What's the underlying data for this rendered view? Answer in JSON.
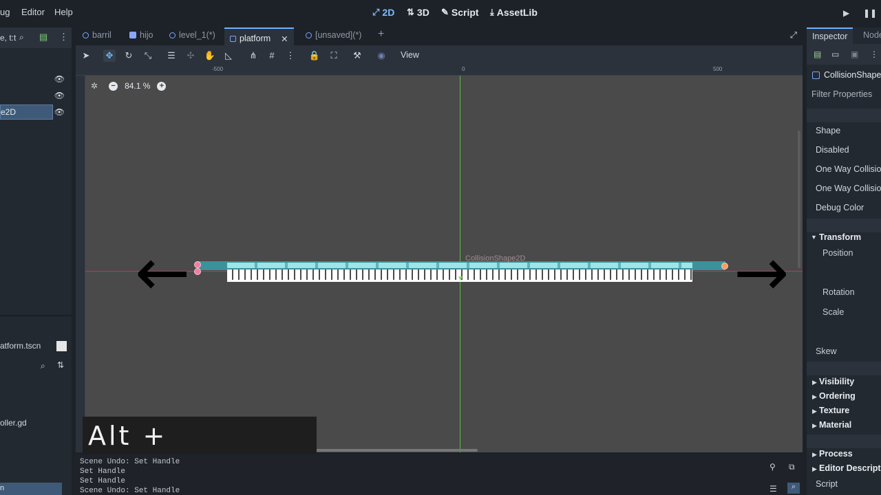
{
  "menu": {
    "debug": "ug",
    "editor": "Editor",
    "help": "Help"
  },
  "workspaces": {
    "ws2d": "2D",
    "ws3d": "3D",
    "script": "Script",
    "assetlib": "AssetLib"
  },
  "left_dock": {
    "filter_text": "e, t:t",
    "selected_node": "e2D",
    "scene_path": "atform.tscn",
    "file_item": "oller.gd",
    "selected_file": "n"
  },
  "tabs": [
    {
      "label": "barril"
    },
    {
      "label": "hijo"
    },
    {
      "label": "level_1(*)"
    },
    {
      "label": "platform"
    },
    {
      "label": "[unsaved](*)"
    }
  ],
  "toolbar": {
    "view_label": "View"
  },
  "rulers": {
    "minus500": "-500",
    "zero": "0",
    "plus500": "500"
  },
  "viewport": {
    "zoom": "84.1 %",
    "node_label": "CollisionShape2D"
  },
  "caption": "Alt + Arrastrar",
  "output": [
    "Scene Undo: Set Handle",
    "Set Handle",
    "Set Handle",
    "Scene Undo: Set Handle"
  ],
  "inspector": {
    "tab_inspector": "Inspector",
    "tab_node": "Node",
    "node_name": "CollisionShape",
    "filter": "Filter Properties",
    "props": {
      "shape": "Shape",
      "disabled": "Disabled",
      "one_way_1": "One Way Collisio",
      "one_way_2": "One Way Collisio",
      "debug_color": "Debug Color"
    },
    "transform": {
      "header": "Transform",
      "position": "Position",
      "rotation": "Rotation",
      "scale": "Scale",
      "skew": "Skew"
    },
    "sections": {
      "visibility": "Visibility",
      "ordering": "Ordering",
      "texture": "Texture",
      "material": "Material",
      "process": "Process",
      "editor_desc": "Editor Descript",
      "script": "Script"
    }
  },
  "colors": {
    "accent": "#6fb3ff",
    "platform": "#3a9aa3",
    "axis_x": "#b83c58",
    "axis_y": "#5fbd43"
  }
}
